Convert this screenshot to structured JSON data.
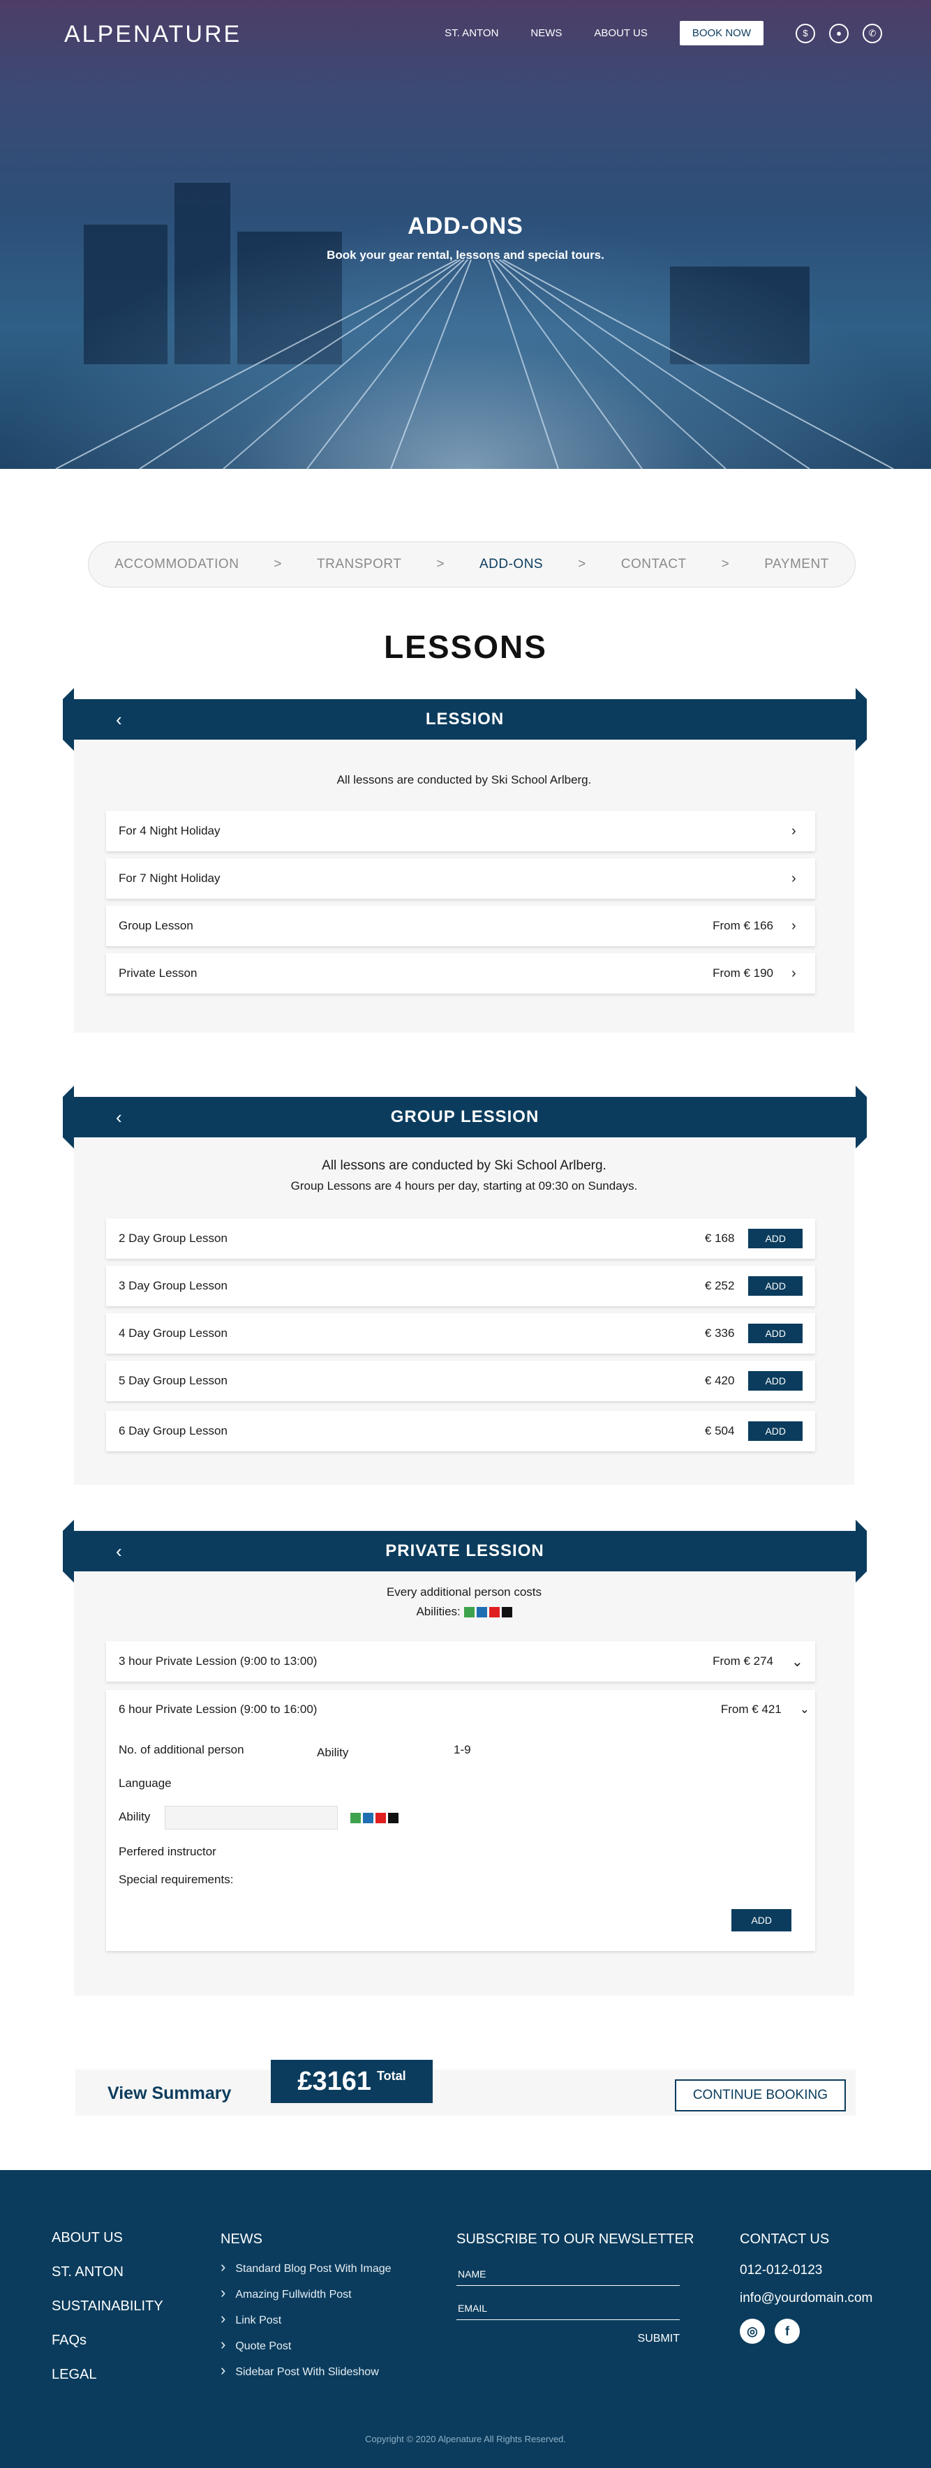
{
  "brand": {
    "logo": "ALPENATURE"
  },
  "nav": {
    "items": [
      "ST. ANTON",
      "NEWS",
      "ABOUT US"
    ],
    "book": "BOOK NOW",
    "icons": [
      "currency-exchange-icon",
      "user-icon",
      "phone-icon"
    ]
  },
  "hero": {
    "title": "ADD-ONS",
    "subtitle": "Book your gear rental, lessons and special tours."
  },
  "steps": [
    "ACCOMMODATION",
    "TRANSPORT",
    "ADD-ONS",
    "CONTACT",
    "PAYMENT"
  ],
  "steps_sep": ">",
  "page_title": "LESSONS",
  "lession": {
    "title": "LESSION",
    "note": "All lessons are conducted by Ski School Arlberg.",
    "rows": [
      {
        "label": "For 4 Night Holiday",
        "price": ""
      },
      {
        "label": "For 7 Night Holiday",
        "price": ""
      },
      {
        "label": "Group Lesson",
        "price": "From € 166"
      },
      {
        "label": "Private Lesson",
        "price": "From € 190"
      }
    ]
  },
  "group": {
    "title": "GROUP LESSION",
    "note1": "All lessons are conducted by Ski School Arlberg.",
    "note2": "Group Lessons are 4 hours per day, starting at 09:30 on Sundays.",
    "add_label": "ADD",
    "rows": [
      {
        "label": "2 Day Group Lesson",
        "price": "€ 168"
      },
      {
        "label": "3 Day Group Lesson",
        "price": "€ 252"
      },
      {
        "label": "4 Day Group Lesson",
        "price": "€ 336"
      },
      {
        "label": "5 Day Group Lesson",
        "price": "€ 420"
      },
      {
        "label": "6 Day Group Lesson",
        "price": "€ 504"
      }
    ]
  },
  "private": {
    "title": "PRIVATE LESSION",
    "note": "Every additional person costs",
    "abilities_label": "Abilities:",
    "ability_colors": [
      "#3fa34d",
      "#1f6fb2",
      "#e02020",
      "#111111"
    ],
    "rows": [
      {
        "label": "3 hour Private Lession (9:00 to 13:00)",
        "price": "From € 274"
      },
      {
        "label": "6 hour Private Lession (9:00 to 16:00)",
        "price": "From € 421"
      }
    ],
    "form": {
      "additional": "No. of additional person",
      "ability_col": "Ability",
      "range": "1-9",
      "language": "Language",
      "ability": "Ability",
      "instructor": "Perfered instructor",
      "special": "Special requirements:",
      "add": "ADD"
    }
  },
  "summary": {
    "view": "View Summary",
    "total": "£3161",
    "total_label": "Total",
    "continue": "CONTINUE BOOKING"
  },
  "footer": {
    "links": [
      "ABOUT US",
      "ST. ANTON",
      "SUSTAINABILITY",
      "FAQs",
      "LEGAL"
    ],
    "news_title": "NEWS",
    "news": [
      "Standard Blog Post With Image",
      "Amazing Fullwidth Post",
      "Link Post",
      "Quote Post",
      "Sidebar Post With Slideshow"
    ],
    "newsletter_title": "SUBSCRIBE TO OUR NEWSLETTER",
    "name_ph": "NAME",
    "email_ph": "EMAIL",
    "submit": "SUBMIT",
    "contact_title": "CONTACT US",
    "phone": "012-012-0123",
    "email": "info@yourdomain.com",
    "copyright": "Copyright © 2020  Alpenature  All Rights Reserved."
  },
  "colors": {
    "primary": "#0b3c5d",
    "panel": "#f6f6f6"
  }
}
